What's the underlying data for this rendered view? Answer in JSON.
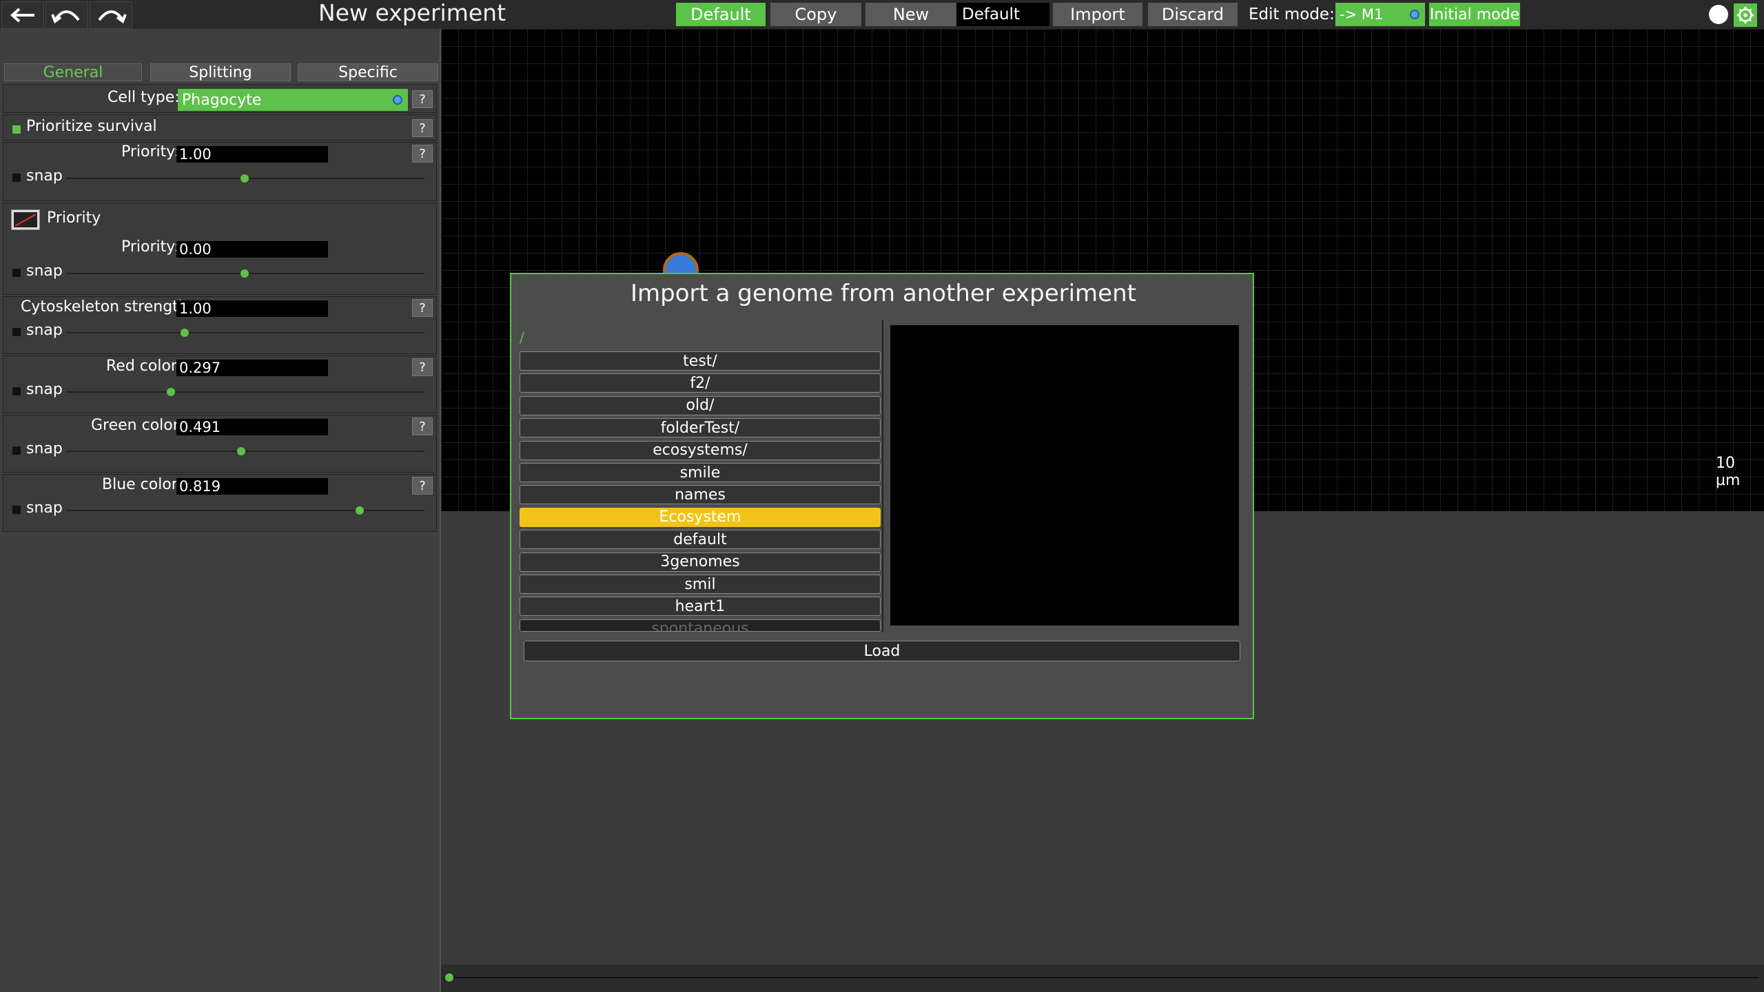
{
  "app": {
    "title": "New experiment",
    "toolbar": {
      "default_button": "Default",
      "copy_button": "Copy",
      "new_button": "New",
      "name_field": "Default",
      "import_button": "Import",
      "discard_button": "Discard",
      "edit_mode_label": "Edit mode:",
      "edit_mode_value": "-> M1",
      "initial_mode_button": "Initial mode"
    }
  },
  "left_panel": {
    "tabs": [
      "General",
      "Splitting",
      "Specific"
    ],
    "cell_type_label": "Cell type:",
    "cell_type_value": "Phagocyte",
    "prioritize_survival_label": "Prioritize survival",
    "priority1": {
      "label": "Priority:",
      "value": "1.00",
      "slider": 0.5
    },
    "priority_graph_label": "Priority",
    "priority2": {
      "label": "Priority:",
      "value": "0.00",
      "slider": 0.5
    },
    "cytoskeleton": {
      "label": "Cytoskeleton strength:",
      "value": "1.00",
      "slider": 0.33
    },
    "red": {
      "label": "Red color:",
      "value": "0.297",
      "slider": 0.297
    },
    "green": {
      "label": "Green color:",
      "value": "0.491",
      "slider": 0.491
    },
    "blue": {
      "label": "Blue color:",
      "value": "0.819",
      "slider": 0.819
    },
    "snap_label": "snap",
    "help_label": "?"
  },
  "canvas": {
    "scale_label": "10 µm"
  },
  "dialog": {
    "title": "Import a genome from another experiment",
    "path": "/",
    "items": [
      "test/",
      "f2/",
      "old/",
      "folderTest/",
      "ecosystems/",
      "smile",
      "names",
      "Ecosystem",
      "default",
      "3genomes",
      "smil",
      "heart1",
      "spontaneous"
    ],
    "selected_index": 7,
    "load_button": "Load"
  },
  "colors": {
    "accent": "#5cc24a",
    "selection": "#f3c418"
  },
  "icons": {
    "back": "arrow-left-icon",
    "undo": "undo-icon",
    "redo": "redo-icon",
    "record": "circle-icon",
    "settings": "gear-icon"
  }
}
